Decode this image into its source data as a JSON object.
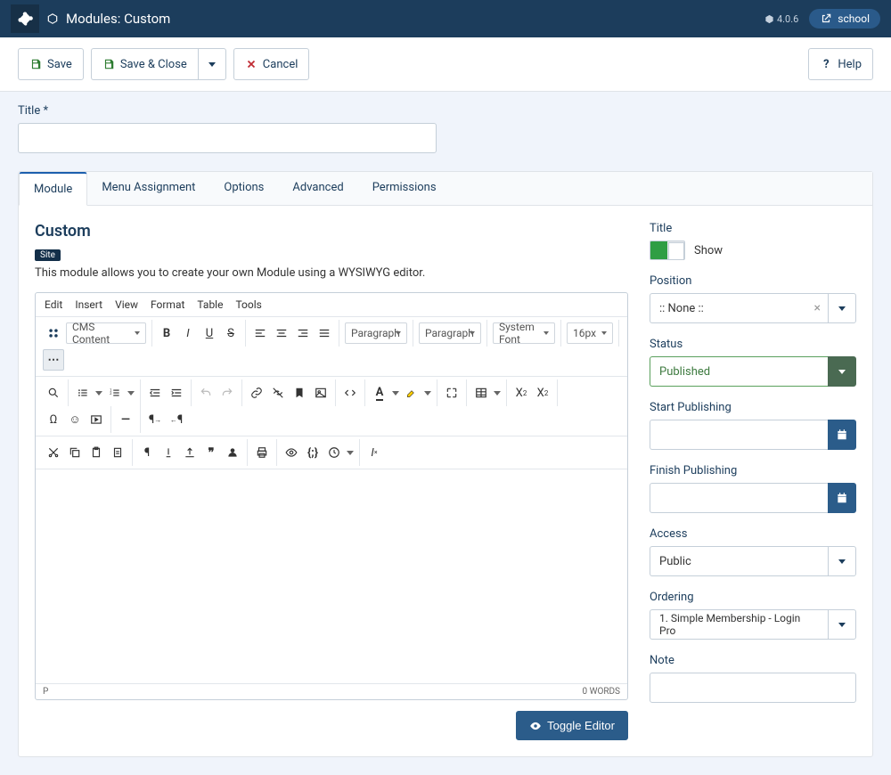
{
  "topbar": {
    "title": "Modules: Custom",
    "version": "4.0.6",
    "site_label": "school"
  },
  "actions": {
    "save": "Save",
    "save_close": "Save & Close",
    "cancel": "Cancel",
    "help": "Help"
  },
  "title_field": {
    "label": "Title *",
    "value": ""
  },
  "tabs": [
    {
      "label": "Module"
    },
    {
      "label": "Menu Assignment"
    },
    {
      "label": "Options"
    },
    {
      "label": "Advanced"
    },
    {
      "label": "Permissions"
    }
  ],
  "module": {
    "heading": "Custom",
    "chip": "Site",
    "description": "This module allows you to create your own Module using a WYSIWYG editor."
  },
  "editor": {
    "menus": [
      "Edit",
      "Insert",
      "View",
      "Format",
      "Table",
      "Tools"
    ],
    "cms_content": "CMS Content",
    "block_format": "Paragraph",
    "style_format": "Paragraph",
    "font_family": "System Font",
    "font_size": "16px",
    "status_path": "P",
    "word_count": "0 WORDS",
    "toggle_btn": "Toggle Editor"
  },
  "sidebar": {
    "title_label": "Title",
    "title_value": "Show",
    "position_label": "Position",
    "position_value": ":: None ::",
    "status_label": "Status",
    "status_value": "Published",
    "start_label": "Start Publishing",
    "start_value": "",
    "finish_label": "Finish Publishing",
    "finish_value": "",
    "access_label": "Access",
    "access_value": "Public",
    "ordering_label": "Ordering",
    "ordering_value": "1. Simple Membership - Login Pro",
    "note_label": "Note",
    "note_value": ""
  }
}
